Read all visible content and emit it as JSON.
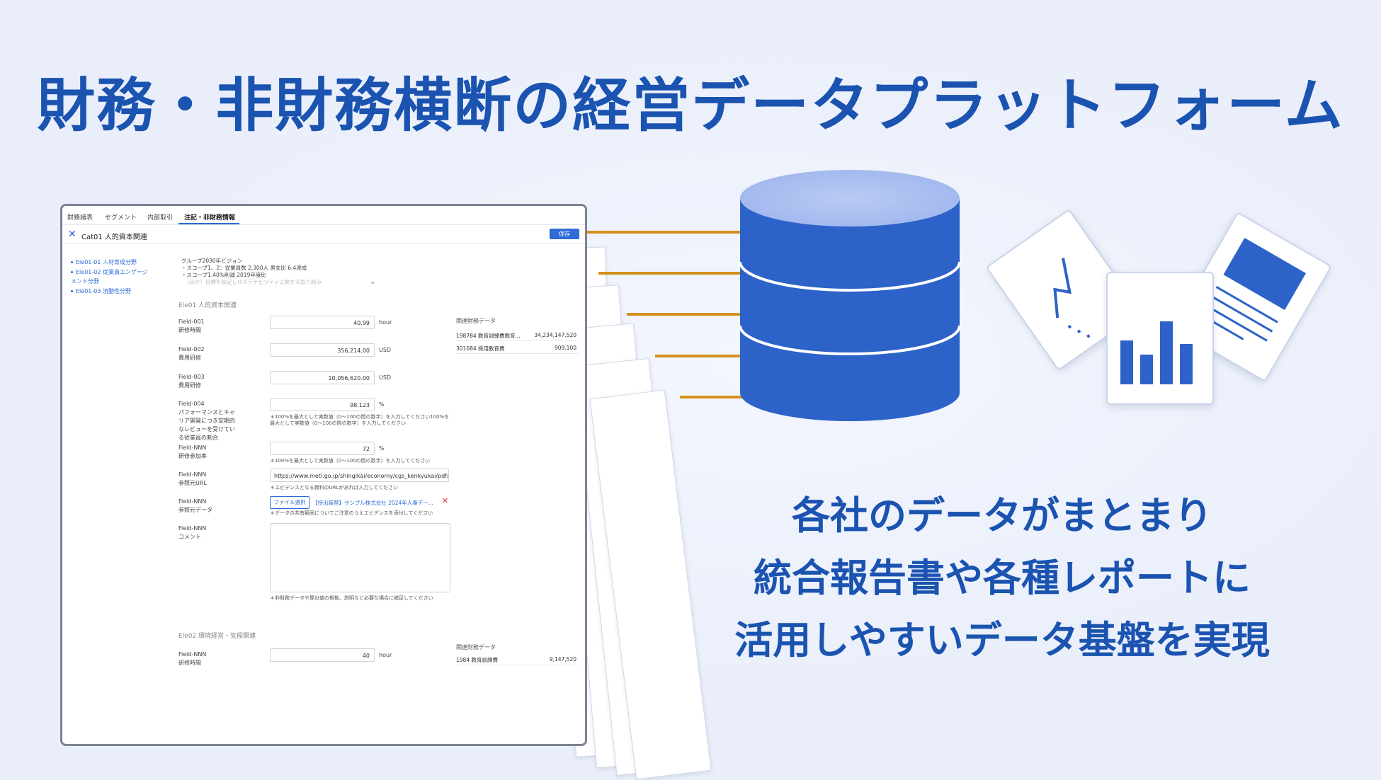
{
  "headline": "財務・非財務横断の経営データプラットフォーム",
  "tagline": {
    "line1": "各社のデータがまとまり",
    "line2": "統合報告書や各種レポートに",
    "line3": "活用しやすいデータ基盤を実現"
  },
  "app": {
    "tabs": [
      "財務諸表",
      "セグメント",
      "内部取引",
      "注記・非財務情報"
    ],
    "active_tab": "注記・非財務情報",
    "category_title": "Cat01 人的資本関連",
    "save_label": "保存",
    "sidebar": [
      "Ele01-01 人材育成分野",
      "Ele01-02 従業員エンゲージメント分野",
      "Ele01-03 流動性分野"
    ],
    "vision": {
      "title": "グループ2030年ビジョン",
      "line1": "・スコープ1、2：従業員数 2,300人 男女比 6:4達成",
      "line2": "・スコープ1.40%削減 2019年度比",
      "line3": "　（ほか）目標を設定しサステナビリティに関する取り組み"
    },
    "section1": "Ele01 人的資本関連",
    "section2": "Ele02 環境経営・気候関連",
    "fields": [
      {
        "code": "Field-001",
        "name": "研修時間",
        "value": "40.99",
        "unit": "hour"
      },
      {
        "code": "Field-002",
        "name": "費用研修",
        "value": "356,214.00",
        "unit": "USD"
      },
      {
        "code": "Field-003",
        "name": "費用研修",
        "value": "10,056,620.00",
        "unit": "USD"
      },
      {
        "code": "Field-004",
        "name": "パフォーマンスとキャリア開発につき定期的なレビューを受けている従業員の割合",
        "value": "98.123",
        "unit": "%",
        "hint": "＊100%を最大として実数値（0〜100の間の数字）を入力してください100%を最大として実数値（0〜100の間の数字）を入力してください"
      },
      {
        "code": "Field-NNN",
        "name": "研修参加率",
        "value": "72",
        "unit": "%",
        "hint": "＊100%を最大として実数値（0〜100の間の数字）を入力してください"
      },
      {
        "code": "Field-NNN",
        "name": "参照元URL",
        "value": "https://www.meti.go.jp/shingikai/economy/cgs_kenkyukai/pdf/20...",
        "hint": "＊エビデンスとなる資料のURLがあれば入力してください"
      },
      {
        "code": "Field-NNN",
        "name": "参照元データ",
        "file_button": "ファイル選択",
        "file_name": "【持出厳禁】サンプル株式会社 2024年人事デー...",
        "hint": "＊データの共有範囲についてご注意のうえエビデンスを添付してください"
      },
      {
        "code": "Field-NNN",
        "name": "コメント",
        "hint": "＊非財務データや算出値の根拠、説明など必要な場合に補足してください"
      },
      {
        "code": "Field-NNN",
        "name": "研修時間",
        "value": "40",
        "unit": "hour"
      }
    ],
    "related1": {
      "title": "関連財務データ",
      "rows": [
        {
          "name": "198784 教育訓練費教育...",
          "value": "34,234,147,520"
        },
        {
          "name": "301684 採用教育費",
          "value": "909,100"
        }
      ]
    },
    "related2": {
      "title": "関連財務データ",
      "rows": [
        {
          "name": "1984 教育訓練費",
          "value": "9,147,520"
        }
      ]
    }
  },
  "colors": {
    "brand_blue": "#1a53b0",
    "db_blue": "#2d62c8",
    "connector_orange": "#d4901e",
    "background": "#e9eefa"
  }
}
